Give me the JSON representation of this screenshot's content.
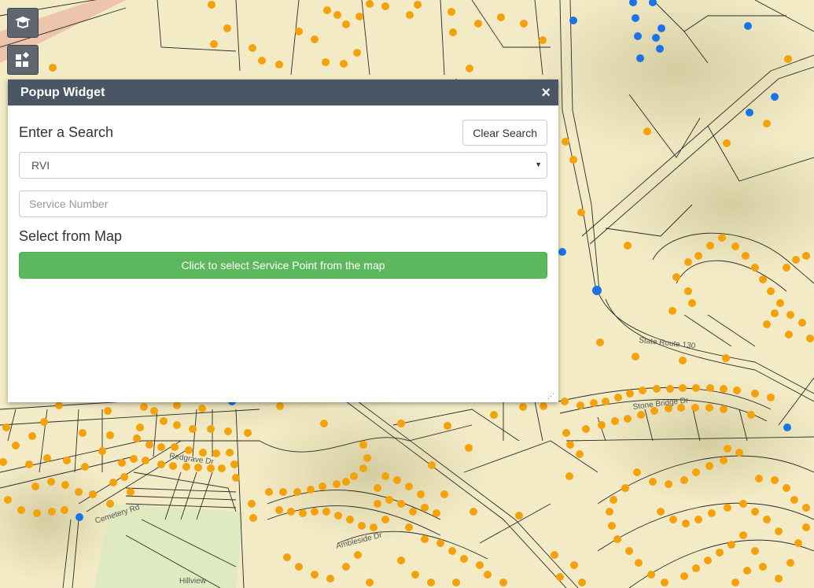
{
  "map": {
    "background_color": "#f3ecc4",
    "orange_point_color": "#f5a20a",
    "blue_point_color": "#1a73e8",
    "street_labels": [
      "Stone Bridge Dr",
      "State Route 130",
      "Cemetery Rd",
      "Ambleside Dr",
      "Redgrave Dr",
      "Hillview"
    ]
  },
  "toolbar": {
    "layers_icon": "layers-icon",
    "widgets_icon": "widgets-icon"
  },
  "popup": {
    "title": "Popup Widget",
    "close_icon": "×",
    "search_label": "Enter a Search",
    "clear_button": "Clear Search",
    "select_value": "RVI",
    "input_placeholder": "Service Number",
    "map_label": "Select from Map",
    "map_button": "Click to select Service Point from the map",
    "accent_color": "#4a5565",
    "button_color": "#5cb85c"
  }
}
